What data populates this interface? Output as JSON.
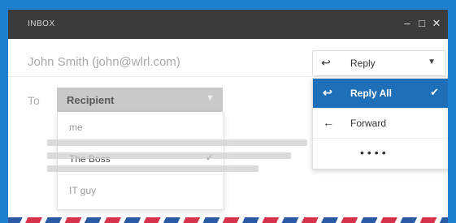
{
  "window": {
    "title": "INBOX",
    "controls": {
      "minimize": "–",
      "maximize": "□",
      "close": "✕"
    }
  },
  "from": {
    "text": "John Smith (john@wlrl.com)"
  },
  "to": {
    "label": "To",
    "selected": "Recipient",
    "options": [
      {
        "label": "me",
        "checked": false
      },
      {
        "label": "The Boss",
        "checked": true
      },
      {
        "label": "IT guy",
        "checked": false
      }
    ],
    "check_glyph": "✔"
  },
  "reply": {
    "selected_label": "Reply",
    "caret": "▼",
    "items": [
      {
        "label": "Reply All",
        "icon": "reply-all-icon",
        "active": true
      },
      {
        "label": "Forward",
        "icon": "forward-icon",
        "active": false
      },
      {
        "label": "••••",
        "icon": "",
        "active": false
      }
    ],
    "active_color": "#1f6fb8"
  },
  "colors": {
    "page_bg": "#1f7fd0",
    "titlebar": "#3b3b3b",
    "stripe_blue": "#2a5aa3",
    "stripe_red": "#d7324b"
  }
}
